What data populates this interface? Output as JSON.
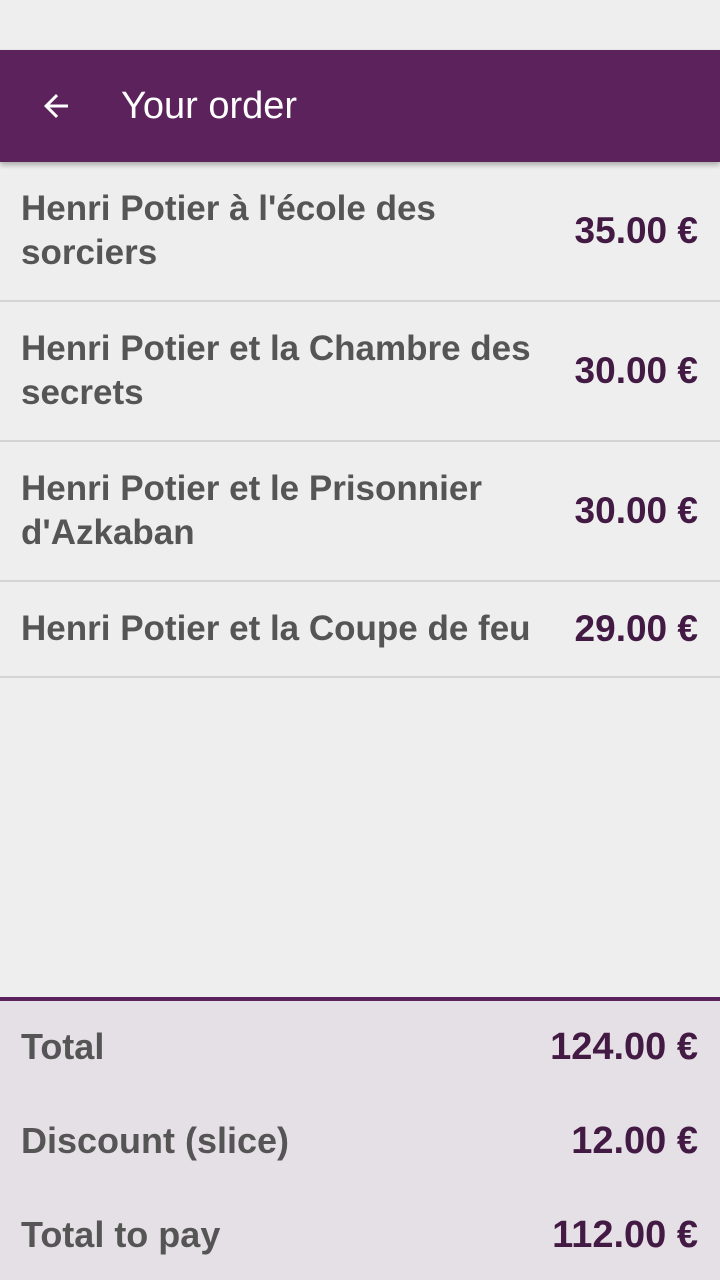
{
  "app_bar": {
    "title": "Your order",
    "back_icon": "arrow-left-icon",
    "color": "#5c225c"
  },
  "items": [
    {
      "title": "Henri Potier à l'école des sorciers",
      "price": "35.00 €"
    },
    {
      "title": "Henri Potier et la Chambre des secrets",
      "price": "30.00 €"
    },
    {
      "title": "Henri Potier et le Prisonnier d'Azkaban",
      "price": "30.00 €"
    },
    {
      "title": "Henri Potier et la Coupe de feu",
      "price": "29.00 €"
    }
  ],
  "summary": {
    "total_label": "Total",
    "total_value": "124.00 €",
    "discount_label": "Discount (slice)",
    "discount_value": "12.00 €",
    "to_pay_label": "Total to pay",
    "to_pay_value": "112.00 €"
  }
}
